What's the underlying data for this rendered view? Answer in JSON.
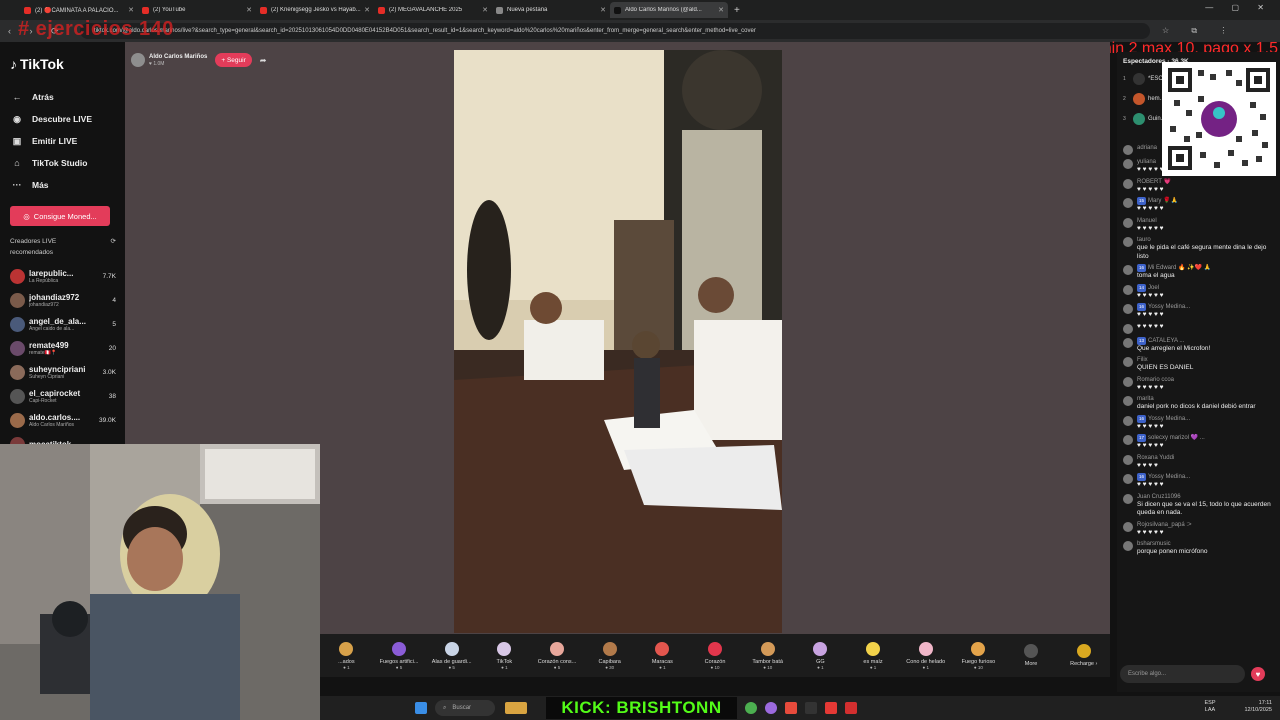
{
  "browser": {
    "tabs": [
      {
        "title": "(2) 🔴CAMINATA A PALACIO..."
      },
      {
        "title": "(2) YouTube"
      },
      {
        "title": "(2) Knenigsegg Jesko vs Hayab..."
      },
      {
        "title": "(2) MEGAVALANCHE 2025"
      },
      {
        "title": "Nueva pestaña"
      },
      {
        "title": "Aldo Carlos Mariños (@ald..."
      }
    ],
    "url": "tiktok.com/@aldo.carlos.marinos/live?&search_type=general&search_id=20251013061054D0DD0480E04152B4D051&search_result_id=1&search_keyword=aldo%20carlos%20mariños&enter_from_merge=general_search&enter_method=live_cover"
  },
  "overlays": {
    "ejercicios": "# ejercicios 140",
    "promo": "min 2 max 10, pago x 1.5"
  },
  "sidebar": {
    "logo": "TikTok",
    "nav": [
      {
        "icon": "back-arrow-icon",
        "label": "Atrás"
      },
      {
        "icon": "compass-icon",
        "label": "Descubre LIVE"
      },
      {
        "icon": "broadcast-icon",
        "label": "Emitir LIVE"
      },
      {
        "icon": "home-icon",
        "label": "TikTok Studio"
      },
      {
        "icon": "more-icon",
        "label": "Más"
      }
    ],
    "coins_button": "Consigue Moned...",
    "recommended_title": "Creadores LIVE recomendados",
    "creators": [
      {
        "name": "larepublic...",
        "sub": "La República",
        "count": "7.7K"
      },
      {
        "name": "johandiaz972",
        "sub": "johandiaz972",
        "count": "4"
      },
      {
        "name": "angel_de_ala...",
        "sub": "Angel caido de ala...",
        "count": "5"
      },
      {
        "name": "remate499",
        "sub": "remate🇵🇪📍",
        "count": "20"
      },
      {
        "name": "suheyncipriani",
        "sub": "Suheyn Cipriani",
        "count": "3.0K"
      },
      {
        "name": "el_capirocket",
        "sub": "Capi-Rocket",
        "count": "38"
      },
      {
        "name": "aldo.carlos....",
        "sub": "Aldo Carlos Mariños",
        "count": "39.0K"
      },
      {
        "name": "mocatiktok",
        "sub": "",
        "count": ""
      }
    ]
  },
  "stream": {
    "host_name": "Aldo Carlos Mariños",
    "host_likes": "1.0M",
    "follow_label": "+ Seguir"
  },
  "gifts": [
    {
      "name": "...ados",
      "price": "1",
      "color": "#d7a14a"
    },
    {
      "name": "Fuegos artifici...",
      "price": "5",
      "color": "#8a5cd6"
    },
    {
      "name": "Alas de guardi...",
      "price": "5",
      "color": "#c9d4e6"
    },
    {
      "name": "TikTok",
      "price": "1",
      "color": "#d8c7e6"
    },
    {
      "name": "Corazón cons...",
      "price": "5",
      "color": "#e8a79b"
    },
    {
      "name": "Capibara",
      "price": "30",
      "color": "#b27a4a"
    },
    {
      "name": "Maracas",
      "price": "1",
      "color": "#e3564e"
    },
    {
      "name": "Corazón",
      "price": "10",
      "color": "#e2364c"
    },
    {
      "name": "Tambor batá",
      "price": "10",
      "color": "#d49a58"
    },
    {
      "name": "GG",
      "price": "1",
      "color": "#c8a3e0"
    },
    {
      "name": "es maíz",
      "price": "1",
      "color": "#f2d24a"
    },
    {
      "name": "Cono de helado",
      "price": "1",
      "color": "#f0b6c8"
    },
    {
      "name": "Fuego furioso",
      "price": "10",
      "color": "#e3a34a"
    },
    {
      "name": "More",
      "price": "",
      "color": "#555555"
    },
    {
      "name": "Recharge ›",
      "price": "",
      "color": "#d9a820"
    }
  ],
  "chat": {
    "spectators_title": "Espectadores · 36.3K",
    "top_viewers": [
      {
        "rank": "1",
        "name": "*ESC..."
      },
      {
        "rank": "2",
        "name": "hem..."
      },
      {
        "rank": "3",
        "name": "Guin..."
      }
    ],
    "messages": [
      {
        "user": "adriana",
        "badge": "",
        "text": ""
      },
      {
        "user": "yuliana",
        "badge": "",
        "text": "♥ ♥ ♥ ♥ ♥"
      },
      {
        "user": "ROBERT 💗",
        "badge": "",
        "text": "♥ ♥ ♥ ♥ ♥"
      },
      {
        "user": "Mary 🌹🙏",
        "badge": "15",
        "text": "♥ ♥ ♥ ♥ ♥"
      },
      {
        "user": "Manuel",
        "badge": "",
        "text": "♥ ♥ ♥ ♥ ♥"
      },
      {
        "user": "tauro",
        "badge": "",
        "text": "que le pida el café segura mente dina le dejo listo"
      },
      {
        "user": "Mi Edward 🔥 ✨❤️ 🙏",
        "badge": "16",
        "text": "toma el agua"
      },
      {
        "user": "Joel",
        "badge": "14",
        "text": "♥ ♥ ♥ ♥ ♥"
      },
      {
        "user": "Yossy Medina...",
        "badge": "16",
        "text": "♥ ♥ ♥ ♥ ♥"
      },
      {
        "user": "",
        "badge": "",
        "text": "♥ ♥ ♥ ♥ ♥"
      },
      {
        "user": "CATALEYA ...",
        "badge": "13",
        "text": "Que arreglen el Microfon!"
      },
      {
        "user": "Filix",
        "badge": "",
        "text": "QUIEN ES DANIEL"
      },
      {
        "user": "Romario ccoa",
        "badge": "",
        "text": "♥ ♥ ♥ ♥ ♥"
      },
      {
        "user": "marita",
        "badge": "",
        "text": "daniel pork no dicos k daniel debió entrar"
      },
      {
        "user": "Yossy Medina...",
        "badge": "16",
        "text": "♥ ♥ ♥ ♥ ♥"
      },
      {
        "user": "solecxy marizol 💜 ...",
        "badge": "17",
        "text": "♥ ♥ ♥ ♥ ♥"
      },
      {
        "user": "Roxana Yuddi",
        "badge": "",
        "text": "♥ ♥ ♥ ♥"
      },
      {
        "user": "Yossy Medina...",
        "badge": "16",
        "text": "♥ ♥ ♥ ♥ ♥"
      },
      {
        "user": "Juan Cruz11096",
        "badge": "",
        "text": "Si dicen que se va el 15, todo lo que acuerden queda en nada."
      },
      {
        "user": "Rojosilvana_papá :>",
        "badge": "",
        "text": "♥ ♥ ♥ ♥ ♥"
      },
      {
        "user": "bsharsmusic",
        "badge": "",
        "text": "porque ponen micrófono"
      }
    ],
    "input_placeholder": "Escribe algo..."
  },
  "taskbar": {
    "search_label": "Buscar",
    "kick_banner": "KICK: BRISHTONN",
    "lang": "ESP LAA",
    "time": "17:11",
    "date": "12/10/2025"
  }
}
